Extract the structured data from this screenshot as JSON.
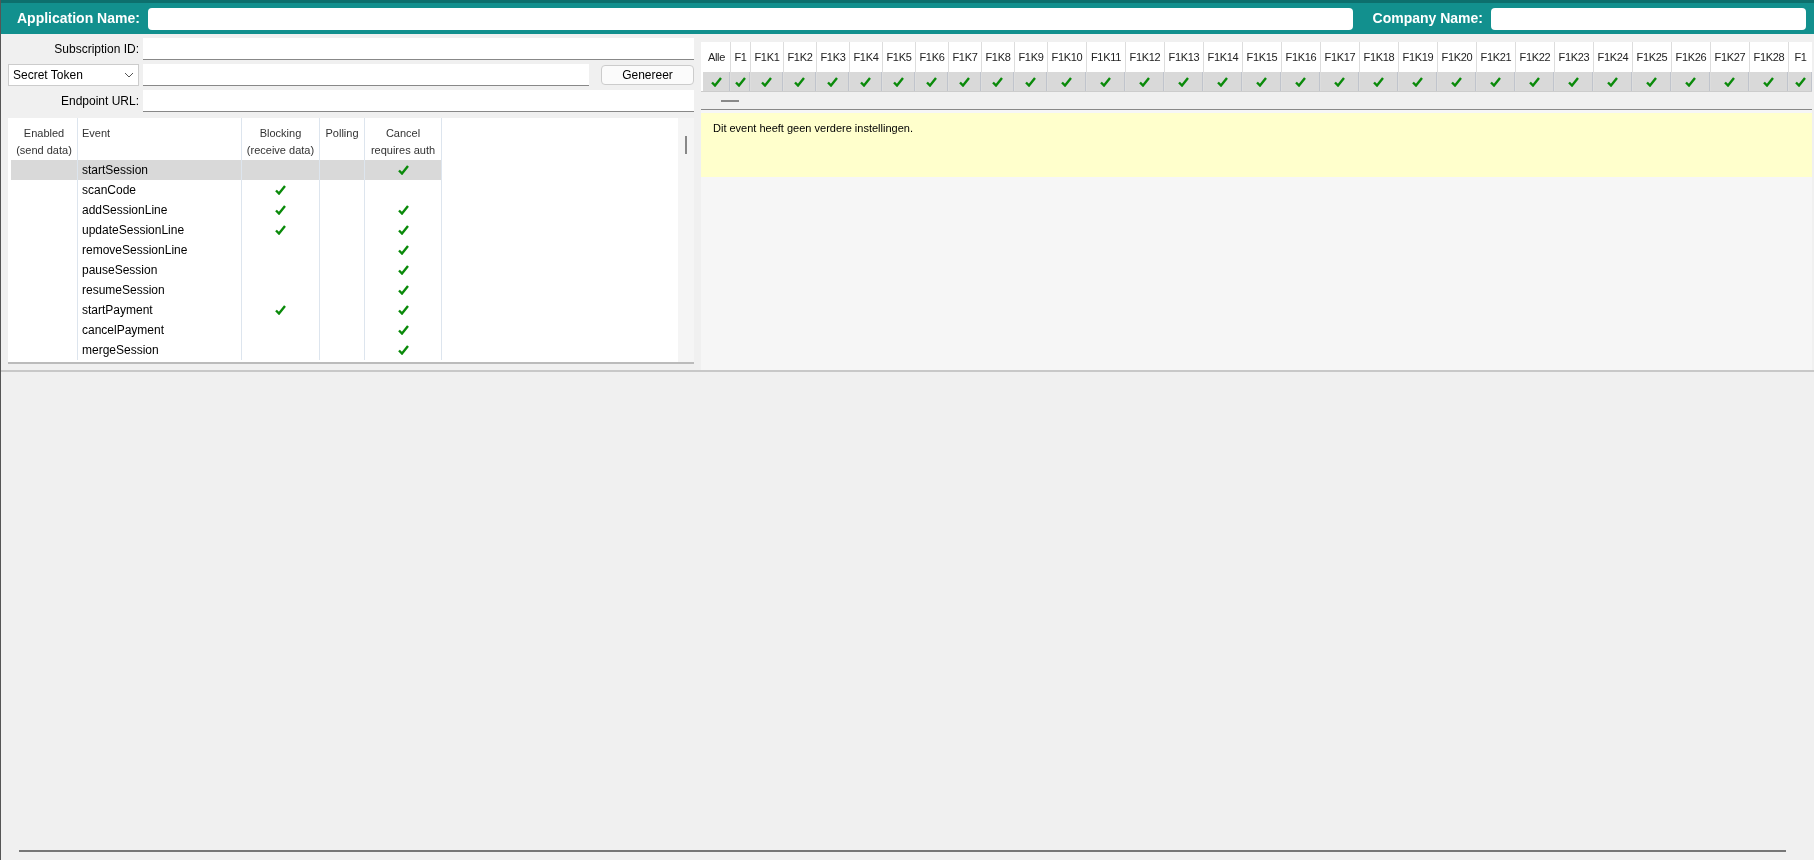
{
  "header": {
    "app_label": "Application Name:",
    "company_label": "Company Name:"
  },
  "form": {
    "subscription_label": "Subscription ID:",
    "token_select": "Secret Token",
    "generate_button": "Genereer",
    "endpoint_label": "Endpoint URL:"
  },
  "events_table": {
    "columns": [
      "Enabled\n(send data)",
      "Event",
      "Blocking\n(receive data)",
      "Polling",
      "Cancel\nrequires auth"
    ],
    "rows": [
      {
        "event": "startSession",
        "blocking": false,
        "polling": false,
        "cancel_requires_auth": true,
        "selected": true
      },
      {
        "event": "scanCode",
        "blocking": true,
        "polling": false,
        "cancel_requires_auth": false,
        "selected": false
      },
      {
        "event": "addSessionLine",
        "blocking": true,
        "polling": false,
        "cancel_requires_auth": true,
        "selected": false
      },
      {
        "event": "updateSessionLine",
        "blocking": true,
        "polling": false,
        "cancel_requires_auth": true,
        "selected": false
      },
      {
        "event": "removeSessionLine",
        "blocking": false,
        "polling": false,
        "cancel_requires_auth": true,
        "selected": false
      },
      {
        "event": "pauseSession",
        "blocking": false,
        "polling": false,
        "cancel_requires_auth": true,
        "selected": false
      },
      {
        "event": "resumeSession",
        "blocking": false,
        "polling": false,
        "cancel_requires_auth": true,
        "selected": false
      },
      {
        "event": "startPayment",
        "blocking": true,
        "polling": false,
        "cancel_requires_auth": true,
        "selected": false
      },
      {
        "event": "cancelPayment",
        "blocking": false,
        "polling": false,
        "cancel_requires_auth": true,
        "selected": false
      },
      {
        "event": "mergeSession",
        "blocking": false,
        "polling": false,
        "cancel_requires_auth": true,
        "selected": false
      }
    ]
  },
  "filter_grid": {
    "columns": [
      {
        "label": "Alle",
        "checked": true
      },
      {
        "label": "F1",
        "checked": true
      },
      {
        "label": "F1K1",
        "checked": true
      },
      {
        "label": "F1K2",
        "checked": true
      },
      {
        "label": "F1K3",
        "checked": true
      },
      {
        "label": "F1K4",
        "checked": true
      },
      {
        "label": "F1K5",
        "checked": true
      },
      {
        "label": "F1K6",
        "checked": true
      },
      {
        "label": "F1K7",
        "checked": true
      },
      {
        "label": "F1K8",
        "checked": true
      },
      {
        "label": "F1K9",
        "checked": true
      },
      {
        "label": "F1K10",
        "checked": true
      },
      {
        "label": "F1K11",
        "checked": true
      },
      {
        "label": "F1K12",
        "checked": true
      },
      {
        "label": "F1K13",
        "checked": true
      },
      {
        "label": "F1K14",
        "checked": true
      },
      {
        "label": "F1K15",
        "checked": true
      },
      {
        "label": "F1K16",
        "checked": true
      },
      {
        "label": "F1K17",
        "checked": true
      },
      {
        "label": "F1K18",
        "checked": true
      },
      {
        "label": "F1K19",
        "checked": true
      },
      {
        "label": "F1K20",
        "checked": true
      },
      {
        "label": "F1K21",
        "checked": true
      },
      {
        "label": "F1K22",
        "checked": true
      },
      {
        "label": "F1K23",
        "checked": true
      },
      {
        "label": "F1K24",
        "checked": true
      },
      {
        "label": "F1K25",
        "checked": true
      },
      {
        "label": "F1K26",
        "checked": true
      },
      {
        "label": "F1K27",
        "checked": true
      },
      {
        "label": "F1K28",
        "checked": true
      },
      {
        "label": "F1",
        "checked": true
      }
    ]
  },
  "note": "Dit event heeft geen verdere instellingen."
}
